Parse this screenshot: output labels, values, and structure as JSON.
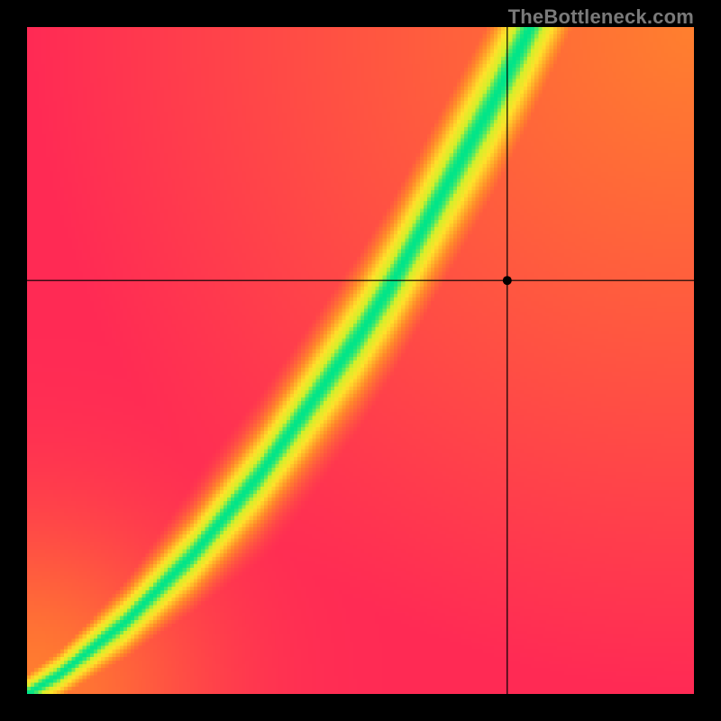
{
  "watermark": "TheBottleneck.com",
  "chart_data": {
    "type": "heatmap",
    "title": "",
    "xlabel": "",
    "ylabel": "",
    "xlim": [
      0,
      1
    ],
    "ylim": [
      0,
      1
    ],
    "crosshair": {
      "x": 0.72,
      "y": 0.62
    },
    "marker_radius": 5,
    "grid_resolution": 180,
    "color_stops": [
      {
        "t": 0.0,
        "hex": "#ff2a55"
      },
      {
        "t": 0.4,
        "hex": "#ff8a2a"
      },
      {
        "t": 0.7,
        "hex": "#ffe22a"
      },
      {
        "t": 0.88,
        "hex": "#d4f02a"
      },
      {
        "t": 1.0,
        "hex": "#00e58a"
      }
    ],
    "ridge": {
      "x": [
        0.0,
        0.05,
        0.1,
        0.15,
        0.2,
        0.25,
        0.3,
        0.35,
        0.4,
        0.45,
        0.5,
        0.55,
        0.6,
        0.65,
        0.7,
        0.75,
        0.8,
        0.85,
        0.9,
        0.95,
        1.0
      ],
      "y": [
        0.0,
        0.03,
        0.07,
        0.11,
        0.16,
        0.21,
        0.27,
        0.33,
        0.4,
        0.47,
        0.54,
        0.62,
        0.71,
        0.8,
        0.89,
        0.99,
        1.1,
        1.21,
        1.33,
        1.45,
        1.58
      ]
    },
    "ridge_width": {
      "base": 0.02,
      "gain": 0.085
    },
    "background_falloff": 0.55,
    "origin_anchor": {
      "x": 0.0,
      "y": 0.0,
      "weight": 0.35,
      "radius": 0.18
    }
  }
}
